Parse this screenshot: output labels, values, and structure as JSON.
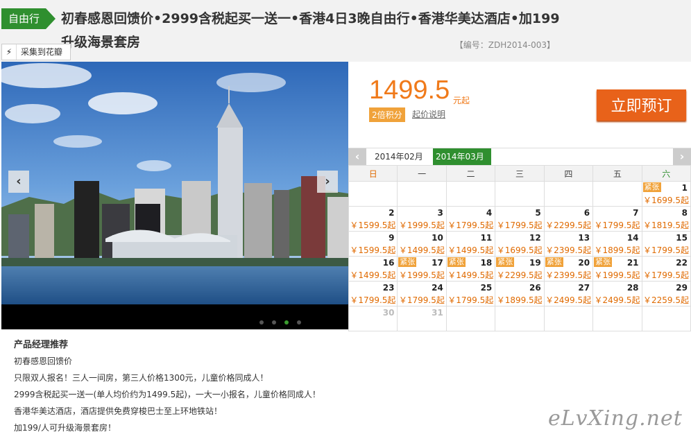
{
  "header": {
    "tag": "自由行",
    "title": "初春感恩回馈价•2999含税起买一送一•香港4日3晚自由行•香港华美达酒店•加199升级海景套房",
    "code": "【编号：ZDH2014-003】",
    "collect_label": "采集到花瓣",
    "collect_icon": "lightning-icon"
  },
  "slider": {
    "prev_icon": "‹",
    "next_icon": "›",
    "active_dot_index": 2,
    "dot_count": 4
  },
  "price": {
    "amount": "1499.5",
    "unit": "元起",
    "points_badge": "2倍积分",
    "link": "起价说明",
    "book_button": "立即预订"
  },
  "calendar": {
    "prev": "‹",
    "next": "›",
    "months": [
      "2014年02月",
      "2014年03月"
    ],
    "active_month": "2014年03月",
    "weekdays": [
      "日",
      "一",
      "二",
      "三",
      "四",
      "五",
      "六"
    ],
    "tight_label": "紧张",
    "weeks": [
      [
        null,
        null,
        null,
        null,
        null,
        null,
        {
          "day": "1",
          "price": "￥1699.5起",
          "tight": true
        }
      ],
      [
        {
          "day": "2",
          "price": "￥1599.5起"
        },
        {
          "day": "3",
          "price": "￥1999.5起"
        },
        {
          "day": "4",
          "price": "￥1799.5起"
        },
        {
          "day": "5",
          "price": "￥1799.5起"
        },
        {
          "day": "6",
          "price": "￥2299.5起"
        },
        {
          "day": "7",
          "price": "￥1799.5起"
        },
        {
          "day": "8",
          "price": "￥1819.5起"
        }
      ],
      [
        {
          "day": "9",
          "price": "￥1599.5起"
        },
        {
          "day": "10",
          "price": "￥1499.5起"
        },
        {
          "day": "11",
          "price": "￥1499.5起"
        },
        {
          "day": "12",
          "price": "￥1699.5起"
        },
        {
          "day": "13",
          "price": "￥2399.5起"
        },
        {
          "day": "14",
          "price": "￥1899.5起"
        },
        {
          "day": "15",
          "price": "￥1799.5起"
        }
      ],
      [
        {
          "day": "16",
          "price": "￥1499.5起"
        },
        {
          "day": "17",
          "price": "￥1999.5起",
          "tight": true
        },
        {
          "day": "18",
          "price": "￥1499.5起",
          "tight": true
        },
        {
          "day": "19",
          "price": "￥2299.5起",
          "tight": true
        },
        {
          "day": "20",
          "price": "￥2399.5起",
          "tight": true
        },
        {
          "day": "21",
          "price": "￥1999.5起",
          "tight": true
        },
        {
          "day": "22",
          "price": "￥1799.5起"
        }
      ],
      [
        {
          "day": "23",
          "price": "￥1799.5起"
        },
        {
          "day": "24",
          "price": "￥1799.5起"
        },
        {
          "day": "25",
          "price": "￥1799.5起"
        },
        {
          "day": "26",
          "price": "￥1899.5起"
        },
        {
          "day": "27",
          "price": "￥2499.5起"
        },
        {
          "day": "28",
          "price": "￥2499.5起"
        },
        {
          "day": "29",
          "price": "￥2259.5起"
        }
      ],
      [
        {
          "day": "30",
          "price": "",
          "gray": true
        },
        {
          "day": "31",
          "price": "",
          "gray": true
        },
        null,
        null,
        null,
        null,
        null
      ]
    ]
  },
  "recommend": {
    "heading": "产品经理推荐",
    "lines": [
      "初春感恩回馈价",
      "只限双人报名！三人一间房，第三人价格1300元，儿童价格同成人！",
      "2999含税起买一送一(单人均价约为1499.5起)，一大一小报名，儿童价格同成人！",
      "香港华美达酒店，酒店提供免费穿梭巴士至上环地铁站！",
      "加199/人可升级海景套房！"
    ]
  },
  "watermark": "eLvXing.net",
  "colors": {
    "accent_green": "#2f8f2f",
    "price_orange": "#f07a1a",
    "book_button": "#e8621a",
    "tight_badge": "#f0a23a"
  }
}
